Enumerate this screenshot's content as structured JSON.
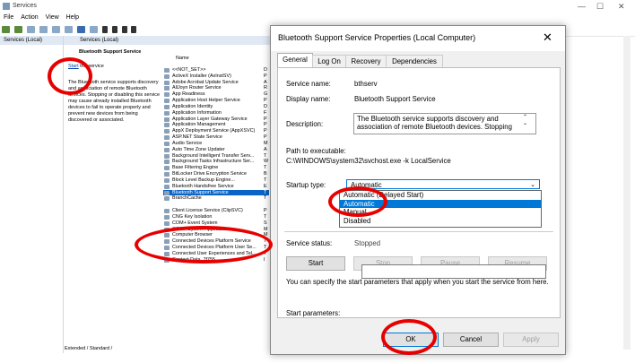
{
  "main": {
    "title": "Services",
    "menu": [
      "File",
      "Action",
      "View",
      "Help"
    ],
    "min": "—",
    "max": "☐",
    "close": "✕",
    "nav_item": "Services (Local)",
    "content_header": "Services (Local)",
    "column_name": "Name",
    "desc_service": "Bluetooth Support Service",
    "desc_link": "Start",
    "desc_link_suffix": " the service",
    "desc_text": "The Bluetooth service supports discovery and association of remote Bluetooth devices. Stopping or disabling this service may cause already installed Bluetooth devices to fail to operate properly and prevent new devices from being discovered or associated.",
    "bottom_tabs": "Extended / Standard /",
    "services": [
      {
        "name": "<<NOT_SET>>",
        "c": "D"
      },
      {
        "name": "ActiveX Installer (AxInstSV)",
        "c": "P"
      },
      {
        "name": "Adobe Acrobat Update Service",
        "c": "A"
      },
      {
        "name": "AllJoyn Router Service",
        "c": "R"
      },
      {
        "name": "App Readiness",
        "c": "G"
      },
      {
        "name": "Application Host Helper Service",
        "c": "P"
      },
      {
        "name": "Application Identity",
        "c": "D"
      },
      {
        "name": "Application Information",
        "c": "F"
      },
      {
        "name": "Application Layer Gateway Service",
        "c": "P"
      },
      {
        "name": "Application Management",
        "c": "P"
      },
      {
        "name": "AppX Deployment Service (AppXSVC)",
        "c": "P"
      },
      {
        "name": "ASP.NET State Service",
        "c": "P"
      },
      {
        "name": "Audio Service",
        "c": "M"
      },
      {
        "name": "Auto Time Zone Updater",
        "c": "A"
      },
      {
        "name": "Background Intelligent Transfer Serv...",
        "c": "T"
      },
      {
        "name": "Background Tasks Infrastructure Ser...",
        "c": "W"
      },
      {
        "name": "Base Filtering Engine",
        "c": "T"
      },
      {
        "name": "BitLocker Drive Encryption Service",
        "c": "B"
      },
      {
        "name": "Block Level Backup Engine...",
        "c": "T"
      },
      {
        "name": "Bluetooth Handsfree Service",
        "c": "E"
      },
      {
        "name": "Bluetooth Support Service",
        "c": "T"
      },
      {
        "name": "BranchCache",
        "c": "T"
      },
      {
        "name": "",
        "c": ""
      },
      {
        "name": "Client License Service (ClipSVC)",
        "c": "P"
      },
      {
        "name": "CNG Key Isolation",
        "c": "T"
      },
      {
        "name": "COM+ Event System",
        "c": "S"
      },
      {
        "name": "COM+ System Application",
        "c": "M"
      },
      {
        "name": "Computer Browser",
        "c": "M"
      },
      {
        "name": "Connected Devices Platform Service",
        "c": "T"
      },
      {
        "name": "Connected Devices Platform User Se...",
        "c": "T"
      },
      {
        "name": "Connected User Experiences and Tel...",
        "c": "T"
      },
      {
        "name": "Contact Data_7f755",
        "c": "I"
      }
    ]
  },
  "dialog": {
    "title": "Bluetooth Support Service Properties (Local Computer)",
    "close": "✕",
    "tabs": [
      "General",
      "Log On",
      "Recovery",
      "Dependencies"
    ],
    "service_name_label": "Service name:",
    "service_name": "bthserv",
    "display_name_label": "Display name:",
    "display_name": "Bluetooth Support Service",
    "description_label": "Description:",
    "description": "The Bluetooth service supports discovery and association of remote Bluetooth devices.  Stopping",
    "path_label": "Path to executable:",
    "path": "C:\\WINDOWS\\system32\\svchost.exe -k LocalService",
    "startup_label": "Startup type:",
    "startup_value": "Automatic",
    "startup_options": [
      "Automatic (Delayed Start)",
      "Automatic",
      "Manual",
      "Disabled"
    ],
    "status_label": "Service status:",
    "status_value": "Stopped",
    "buttons": {
      "start": "Start",
      "stop": "Stop",
      "pause": "Pause",
      "resume": "Resume"
    },
    "params_help": "You can specify the start parameters that apply when you start the service from here.",
    "params_label": "Start parameters:",
    "ok": "OK",
    "cancel": "Cancel",
    "apply": "Apply"
  },
  "colors": {
    "selection": "#0a64c8",
    "annotation": "#e60000",
    "dialog_bg": "#f0f0f0"
  }
}
